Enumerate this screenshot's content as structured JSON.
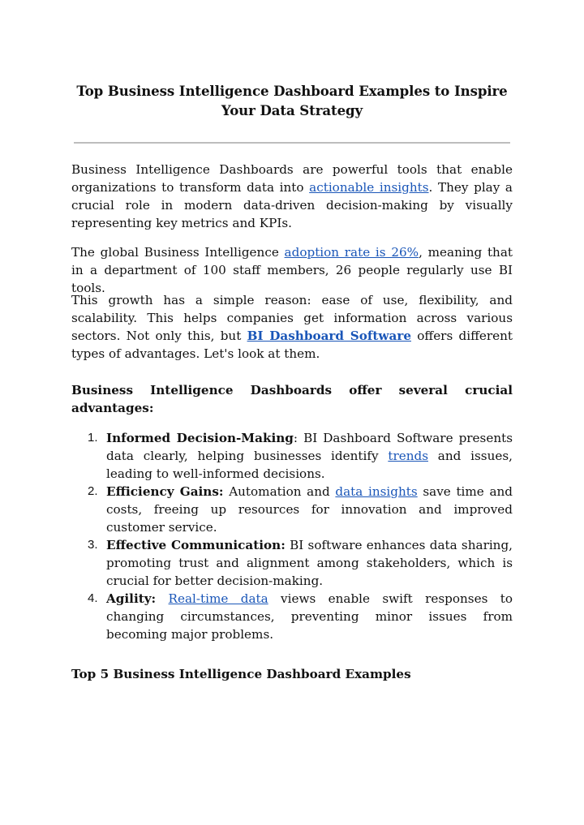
{
  "document": {
    "title": "Top Business Intelligence Dashboard Examples to Inspire Your Data Strategy",
    "intro": {
      "before": "Business Intelligence Dashboards are powerful tools that enable organizations to transform data into ",
      "link": "actionable insights",
      "after": ". They play a crucial role in modern data-driven decision-making by visually representing key metrics and KPIs."
    },
    "adoption": {
      "before": "The global Business Intelligence ",
      "link": "adoption rate is 26%",
      "after": ", meaning that in a department of 100 staff members, 26 people regularly use BI tools."
    },
    "growth": {
      "before": "This growth has a simple reason: ease of use, flexibility, and scalability. This helps companies get information across various sectors. Not only this, but ",
      "link": "BI Dashboard Software",
      "after": " offers different types of advantages. Let's look at them."
    },
    "advantages_heading": "Business Intelligence Dashboards offer several crucial advantages:",
    "advantages": [
      {
        "num": "1.",
        "term": "Informed Decision-Making",
        "sep": ": ",
        "before": "BI Dashboard Software presents data clearly, helping businesses identify ",
        "link": "trends",
        "after": " and issues, leading to well-informed decisions."
      },
      {
        "num": "2.",
        "term": "Efficiency Gains:",
        "sep": " ",
        "before": "Automation and ",
        "link": "data insights",
        "after": " save time and costs, freeing up resources for innovation and improved customer service."
      },
      {
        "num": "3.",
        "term": "Effective Communication:",
        "sep": " ",
        "before": "BI software enhances data sharing, promoting trust and alignment among stakeholders, which is crucial for better decision-making.",
        "link": "",
        "after": ""
      },
      {
        "num": "4.",
        "term": "Agility:",
        "sep": " ",
        "before": "",
        "link": "Real-time data",
        "after": " views enable swift responses to changing circumstances, preventing minor issues from becoming major problems."
      }
    ],
    "examples_heading": "Top 5 Business Intelligence Dashboard Examples"
  },
  "colors": {
    "link": "#1a56b8",
    "rule": "#bdbdbd",
    "text": "#111111"
  }
}
